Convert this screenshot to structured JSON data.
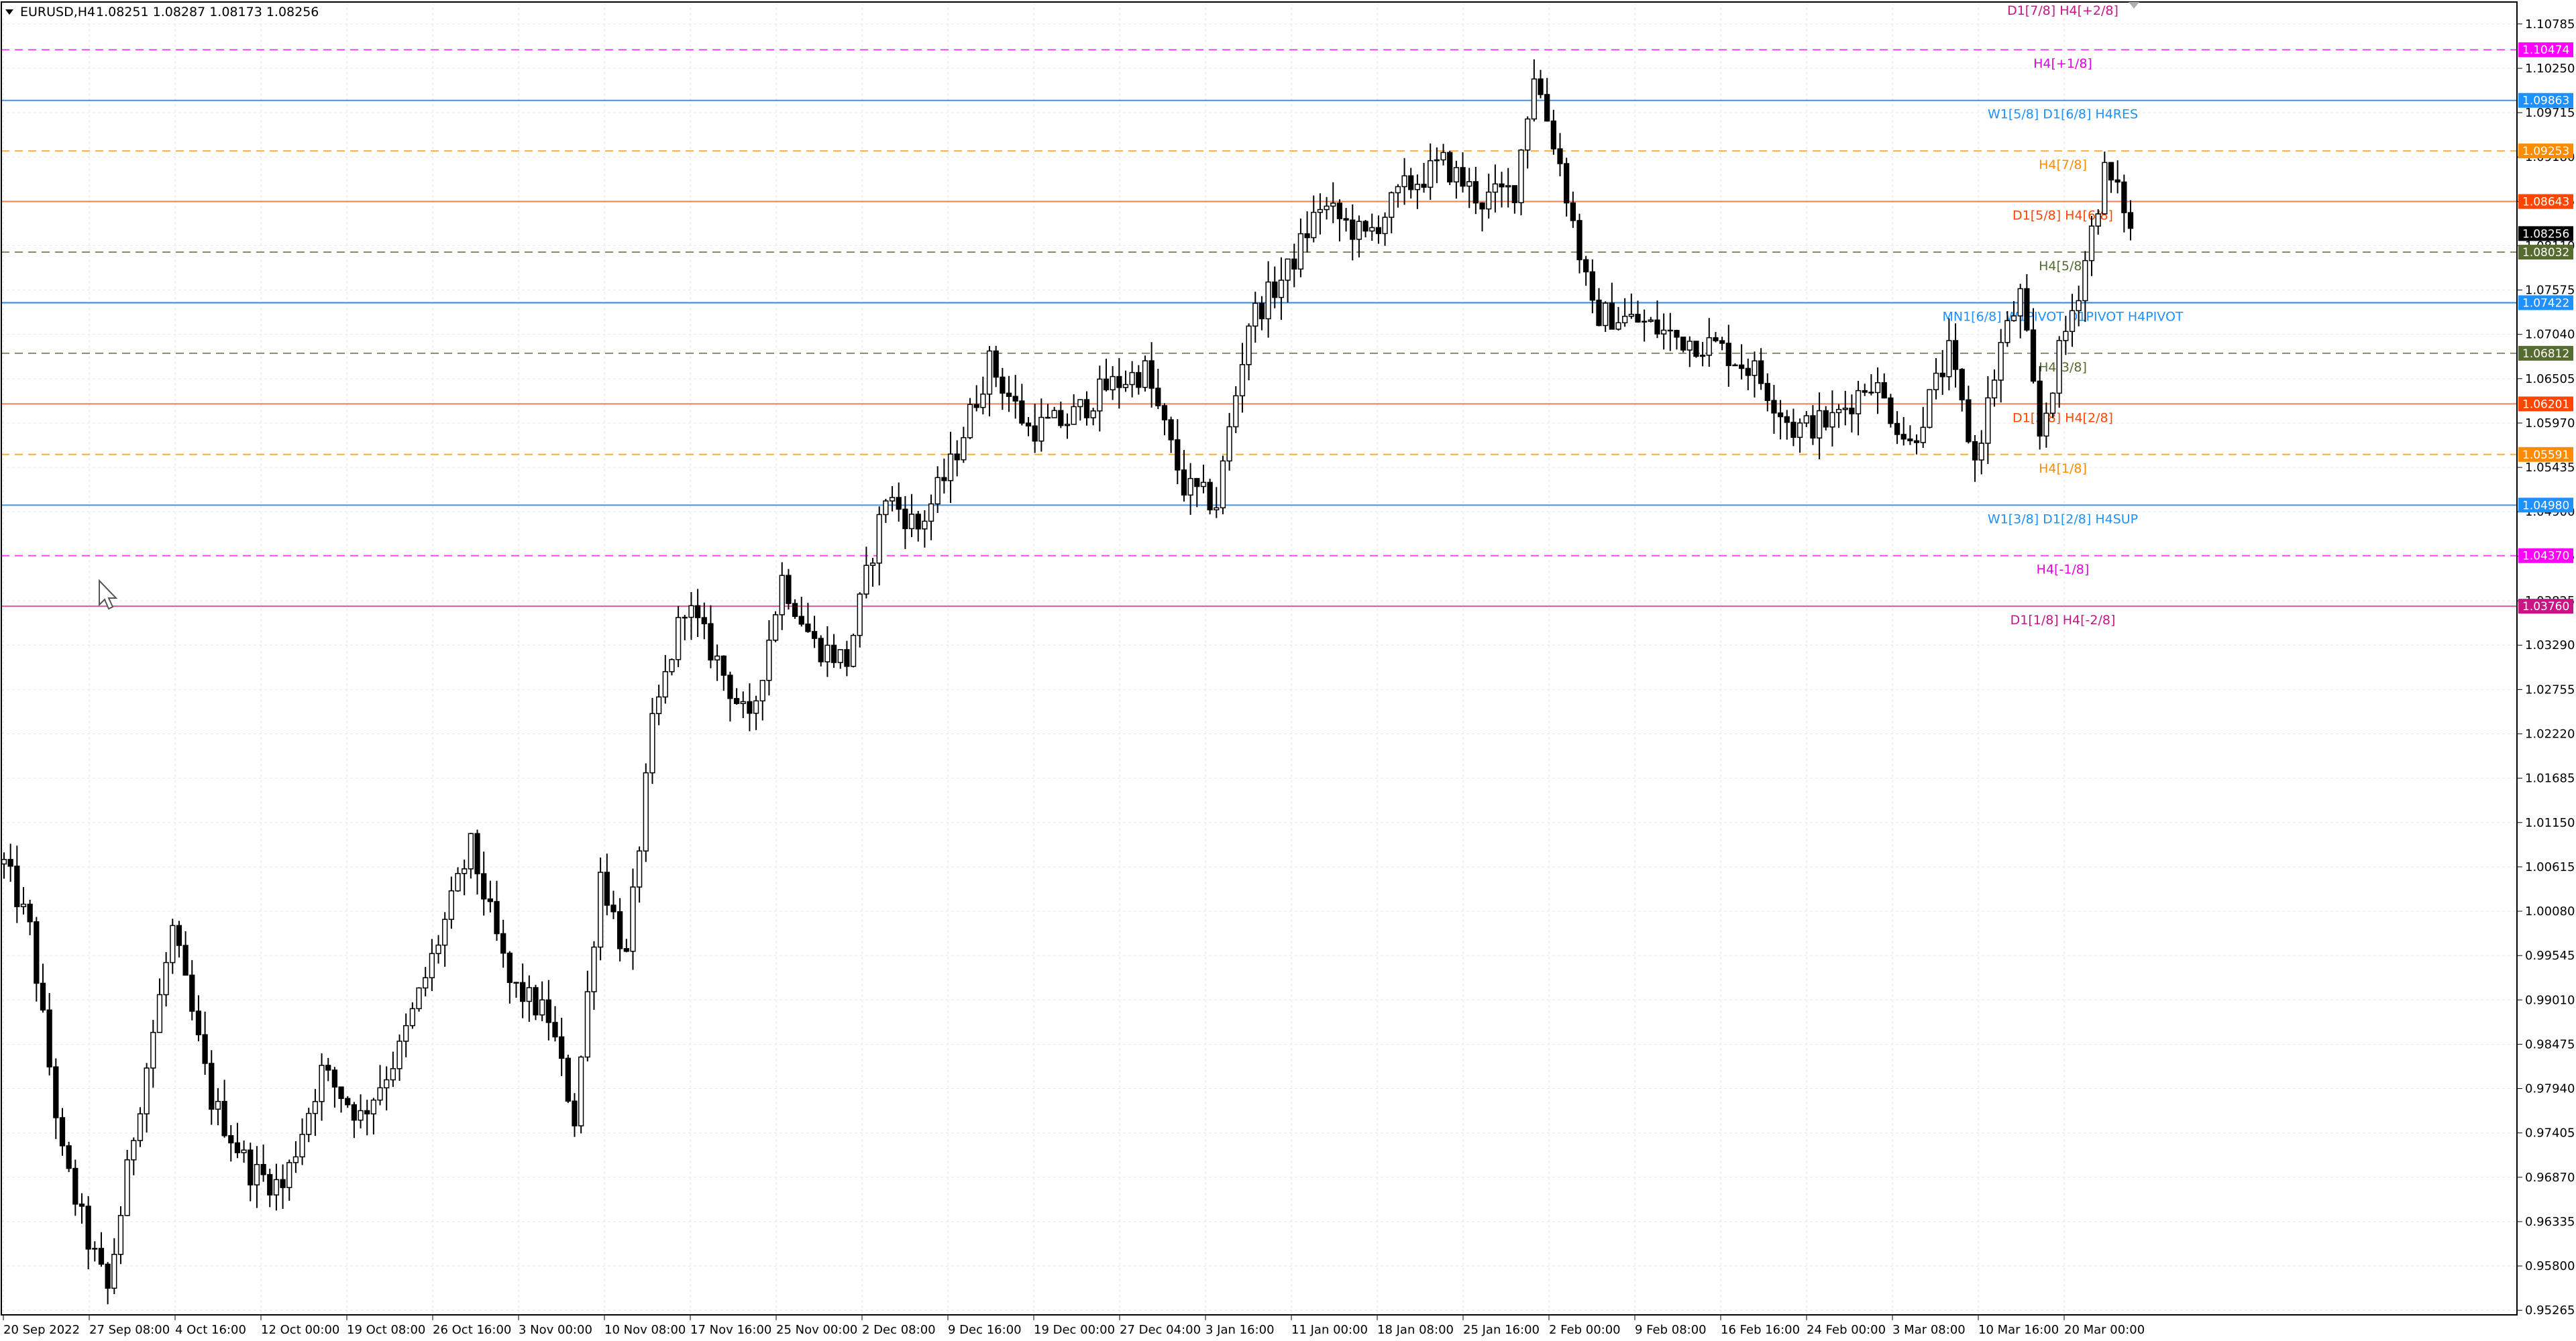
{
  "header": {
    "symbol_label": "EURUSD,H4",
    "ohlc": "1.08251 1.08287 1.08173 1.08256"
  },
  "chart_data": {
    "type": "candlestick",
    "symbol": "EURUSD",
    "timeframe": "H4",
    "ylim": [
      0.9521,
      1.1105
    ],
    "y_ticks": [
      "1.10785",
      "1.10250",
      "1.09715",
      "1.09180",
      "1.08645",
      "1.08110",
      "1.07575",
      "1.07040",
      "1.06505",
      "1.05970",
      "1.05435",
      "1.04900",
      "1.04365",
      "1.03825",
      "1.03290",
      "1.02755",
      "1.02220",
      "1.01685",
      "1.01150",
      "1.00615",
      "1.00080",
      "0.99545",
      "0.99010",
      "0.98475",
      "0.97940",
      "0.97405",
      "0.96870",
      "0.96335",
      "0.95800",
      "0.95265"
    ],
    "x_ticks": [
      "20 Sep 2022",
      "27 Sep 08:00",
      "4 Oct 16:00",
      "12 Oct 00:00",
      "19 Oct 08:00",
      "26 Oct 16:00",
      "3 Nov 00:00",
      "10 Nov 08:00",
      "17 Nov 16:00",
      "25 Nov 00:00",
      "2 Dec 08:00",
      "9 Dec 16:00",
      "19 Dec 00:00",
      "27 Dec 04:00",
      "3 Jan 16:00",
      "11 Jan 00:00",
      "18 Jan 08:00",
      "25 Jan 16:00",
      "2 Feb 00:00",
      "9 Feb 08:00",
      "16 Feb 16:00",
      "24 Feb 00:00",
      "3 Mar 08:00",
      "10 Mar 16:00",
      "20 Mar 00:00"
    ],
    "price_path": [
      [
        0,
        1.0065
      ],
      [
        4,
        0.9985
      ],
      [
        9,
        0.9712
      ],
      [
        13,
        0.961
      ],
      [
        16,
        0.955
      ],
      [
        20,
        0.974
      ],
      [
        26,
        0.9985
      ],
      [
        32,
        0.978
      ],
      [
        38,
        0.9695
      ],
      [
        43,
        0.9675
      ],
      [
        49,
        0.9815
      ],
      [
        55,
        0.976
      ],
      [
        61,
        0.984
      ],
      [
        66,
        0.995
      ],
      [
        72,
        1.0085
      ],
      [
        78,
        0.992
      ],
      [
        84,
        0.988
      ],
      [
        88,
        0.9758
      ],
      [
        92,
        1.0055
      ],
      [
        96,
        0.995
      ],
      [
        100,
        1.023
      ],
      [
        105,
        1.038
      ],
      [
        110,
        1.031
      ],
      [
        115,
        1.023
      ],
      [
        120,
        1.041
      ],
      [
        125,
        1.033
      ],
      [
        130,
        1.031
      ],
      [
        136,
        1.051
      ],
      [
        141,
        1.047
      ],
      [
        146,
        1.0545
      ],
      [
        152,
        1.067
      ],
      [
        158,
        1.059
      ],
      [
        164,
        1.06
      ],
      [
        170,
        1.064
      ],
      [
        176,
        1.066
      ],
      [
        182,
        1.052
      ],
      [
        187,
        1.05
      ],
      [
        192,
        1.072
      ],
      [
        198,
        1.078
      ],
      [
        203,
        1.086
      ],
      [
        210,
        1.082
      ],
      [
        216,
        1.088
      ],
      [
        222,
        1.091
      ],
      [
        228,
        1.0865
      ],
      [
        233,
        1.088
      ],
      [
        236,
        1.102
      ],
      [
        240,
        1.091
      ],
      [
        245,
        1.073
      ],
      [
        252,
        1.072
      ],
      [
        258,
        1.07
      ],
      [
        264,
        1.069
      ],
      [
        270,
        1.066
      ],
      [
        276,
        1.059
      ],
      [
        282,
        1.06
      ],
      [
        288,
        1.065
      ],
      [
        294,
        1.057
      ],
      [
        300,
        1.068
      ],
      [
        304,
        1.055
      ],
      [
        308,
        1.069
      ],
      [
        311,
        1.075
      ],
      [
        314,
        1.058
      ],
      [
        317,
        1.068
      ],
      [
        320,
        1.076
      ],
      [
        324,
        1.09
      ],
      [
        327,
        1.086
      ],
      [
        328,
        1.0826
      ]
    ],
    "levels": [
      {
        "label": "D1[7/8] H4[+2/8]",
        "price": 1.1105,
        "tag": "",
        "line_color": "#c71585",
        "text_color": "#c71585",
        "dash": false,
        "show_line": false
      },
      {
        "label": "H4[+1/8]",
        "price": 1.10474,
        "tag": "1.10474",
        "line_color": "#ff44ff",
        "text_color": "#e000e0",
        "tag_bg": "#ff00ff",
        "dash": true
      },
      {
        "label": "W1[5/8] D1[6/8] H4RES",
        "price": 1.09863,
        "tag": "1.09863",
        "line_color": "#4a90e2",
        "text_color": "#1e90ff",
        "tag_bg": "#1e90ff",
        "dash": false
      },
      {
        "label": "H4[7/8]",
        "price": 1.09253,
        "tag": "1.09253",
        "line_color": "#f5b041",
        "text_color": "#ff8c00",
        "tag_bg": "#ff8c00",
        "dash": true
      },
      {
        "label": "D1[5/8] H4[6/8]",
        "price": 1.08643,
        "tag": "1.08643",
        "line_color": "#f08050",
        "text_color": "#ff4500",
        "tag_bg": "#ff4500",
        "dash": false
      },
      {
        "label": "H4[5/8]",
        "price": 1.08032,
        "tag": "1.08032",
        "line_color": "#8b8b6b",
        "text_color": "#556b2f",
        "tag_bg": "#556b2f",
        "dash": true
      },
      {
        "label": "MN1[6/8] W1PIVOT D1PIVOT H4PIVOT",
        "price": 1.07422,
        "tag": "1.07422",
        "line_color": "#2e86de",
        "text_color": "#1e90ff",
        "tag_bg": "#1e90ff",
        "dash": false
      },
      {
        "label": "H4[3/8]",
        "price": 1.06812,
        "tag": "1.06812",
        "line_color": "#8b8b6b",
        "text_color": "#556b2f",
        "tag_bg": "#556b2f",
        "dash": true
      },
      {
        "label": "D1[3/8] H4[2/8]",
        "price": 1.06201,
        "tag": "1.06201",
        "line_color": "#f08050",
        "text_color": "#ff4500",
        "tag_bg": "#ff4500",
        "dash": false
      },
      {
        "label": "H4[1/8]",
        "price": 1.05591,
        "tag": "1.05591",
        "line_color": "#f5b041",
        "text_color": "#ff8c00",
        "tag_bg": "#ff8c00",
        "dash": true
      },
      {
        "label": "W1[3/8] D1[2/8] H4SUP",
        "price": 1.0498,
        "tag": "1.04980",
        "line_color": "#4a90e2",
        "text_color": "#1e90ff",
        "tag_bg": "#1e90ff",
        "dash": false
      },
      {
        "label": "H4[-1/8]",
        "price": 1.0437,
        "tag": "1.04370",
        "line_color": "#ff44ff",
        "text_color": "#e000e0",
        "tag_bg": "#ff00ff",
        "dash": true
      },
      {
        "label": "D1[1/8] H4[-2/8]",
        "price": 1.0376,
        "tag": "1.03760",
        "line_color": "#e0559a",
        "text_color": "#c71585",
        "tag_bg": "#c71585",
        "dash": false
      }
    ],
    "current_price": {
      "value": 1.08256,
      "tag": "1.08256"
    },
    "grid": true
  },
  "colors": {
    "background": "#ffffff",
    "grid": "#e6e6e6",
    "candle": "#000000",
    "current_price_tag": "#000000"
  }
}
